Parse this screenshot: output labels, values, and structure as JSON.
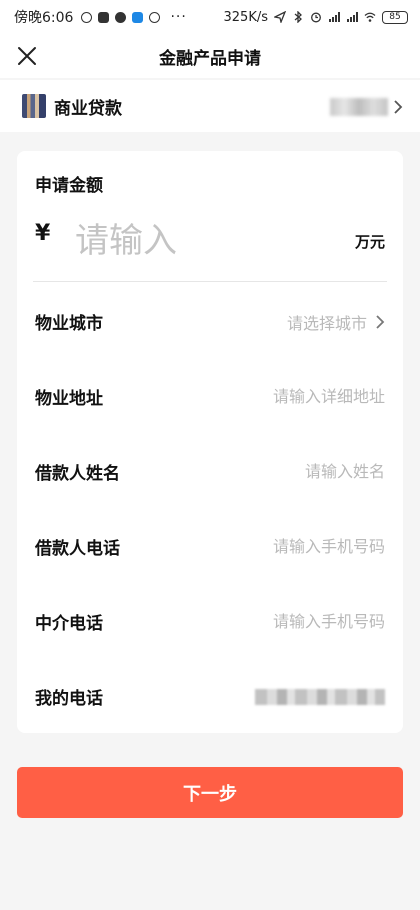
{
  "status_bar": {
    "time": "傍晚6:06",
    "more": "···",
    "speed": "325K/s",
    "battery": "85"
  },
  "nav": {
    "title": "金融产品申请"
  },
  "product": {
    "name": "商业贷款"
  },
  "form": {
    "amount_label": "申请金额",
    "currency_symbol": "¥",
    "amount_placeholder": "请输入",
    "amount_unit": "万元",
    "fields": [
      {
        "label": "物业城市",
        "placeholder": "请选择城市"
      },
      {
        "label": "物业地址",
        "placeholder": "请输入详细地址"
      },
      {
        "label": "借款人姓名",
        "placeholder": "请输入姓名"
      },
      {
        "label": "借款人电话",
        "placeholder": "请输入手机号码"
      },
      {
        "label": "中介电话",
        "placeholder": "请输入手机号码"
      },
      {
        "label": "我的电话"
      }
    ]
  },
  "actions": {
    "next_label": "下一步"
  },
  "colors": {
    "primary": "#ff5f45",
    "placeholder": "#b9b9b9",
    "background": "#f5f5f5"
  }
}
